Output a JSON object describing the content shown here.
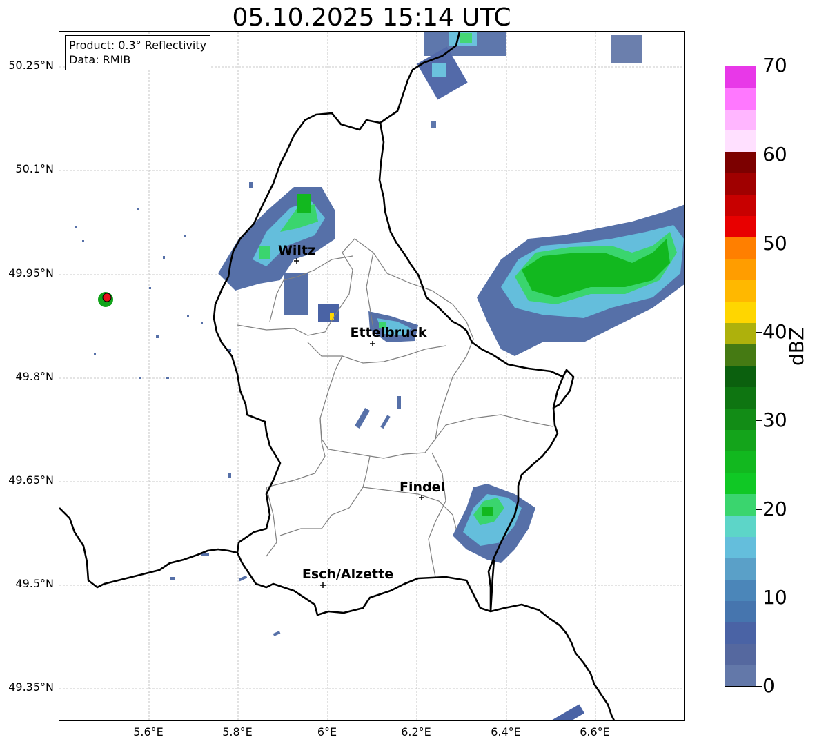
{
  "title": "05.10.2025 15:14 UTC",
  "info_box": {
    "product": "Product: 0.3° Reflectivity",
    "data_source": "Data: RMIB"
  },
  "axes": {
    "y_ticks": [
      "50.25°N",
      "50.1°N",
      "49.95°N",
      "49.8°N",
      "49.65°N",
      "49.5°N",
      "49.35°N"
    ],
    "x_ticks": [
      "5.6°E",
      "5.8°E",
      "6°E",
      "6.2°E",
      "6.4°E",
      "6.6°E"
    ],
    "lon_range": [
      5.4,
      6.8
    ],
    "lat_range": [
      49.3,
      50.3
    ],
    "gridlines": true
  },
  "cities": [
    {
      "name": "Wiltz",
      "lon": 5.93,
      "lat": 49.97
    },
    {
      "name": "Ettelbruck",
      "lon": 6.1,
      "lat": 49.85
    },
    {
      "name": "Findel",
      "lon": 6.21,
      "lat": 49.63
    },
    {
      "name": "Esch/Alzette",
      "lon": 5.99,
      "lat": 49.5
    }
  ],
  "radar_site": {
    "lon": 5.51,
    "lat": 49.915,
    "marker_color": "#e8101a"
  },
  "colorbar": {
    "label": "dBZ",
    "ticks": [
      "0",
      "10",
      "20",
      "30",
      "40",
      "50",
      "60",
      "70"
    ],
    "range": [
      0,
      70
    ],
    "colors": [
      "#6378a9",
      "#55689f",
      "#4a63a5",
      "#4675ae",
      "#4b86b9",
      "#5aa0c8",
      "#64bedc",
      "#5dd5c8",
      "#3ad56e",
      "#10c825",
      "#12b81f",
      "#14a41b",
      "#128c16",
      "#0e7511",
      "#0b600e",
      "#457a13",
      "#aeb10c",
      "#ffd600",
      "#ffb800",
      "#ff9d00",
      "#ff7f00",
      "#e80000",
      "#c80000",
      "#a00000",
      "#7c0000",
      "#ffe0ff",
      "#ffb6ff",
      "#ff78ff",
      "#e838e8"
    ]
  }
}
